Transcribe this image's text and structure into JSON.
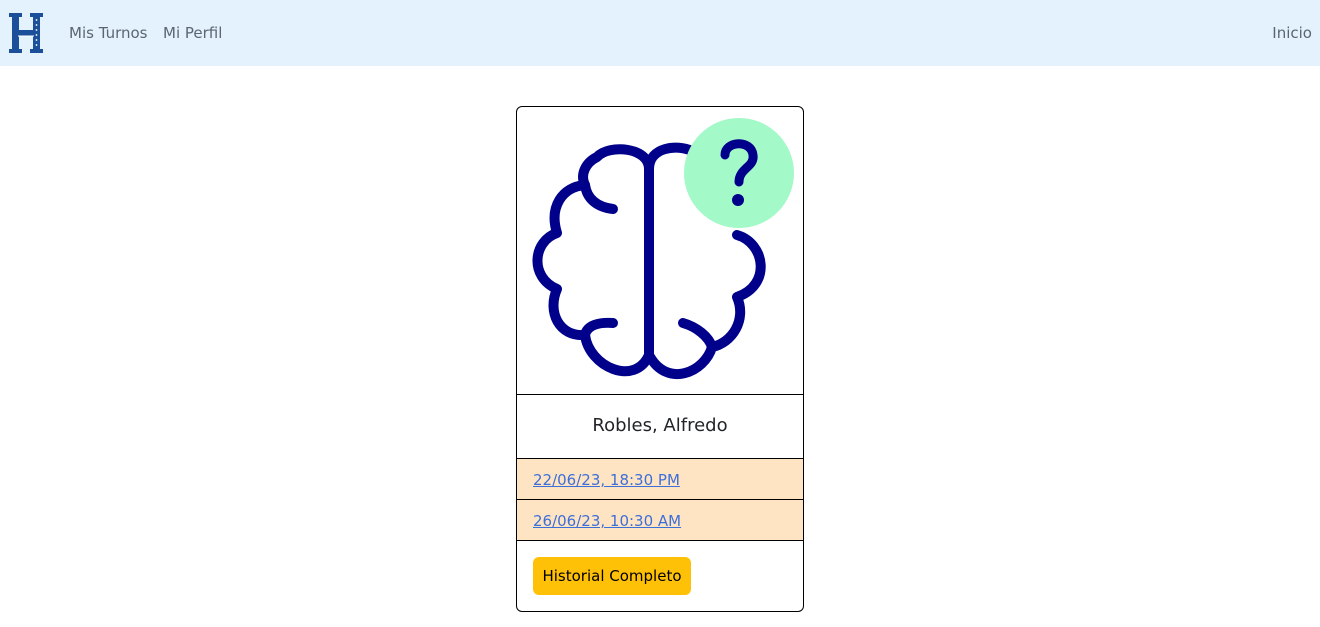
{
  "navbar": {
    "brand_icon": "hospital-h-logo",
    "links": {
      "mis_turnos": "Mis Turnos",
      "mi_perfil": "Mi Perfil",
      "inicio": "Inicio"
    },
    "background": "#e3f2fd"
  },
  "card": {
    "image_icon": "brain-question-icon",
    "doctor_name": "Robles, Alfredo",
    "appointments": [
      {
        "label": "22/06/23, 18:30 PM"
      },
      {
        "label": "26/06/23, 10:30 AM"
      }
    ],
    "history_button": "Historial Completo",
    "colors": {
      "brain_stroke": "#00008b",
      "question_circle": "#a3f9c8",
      "appointment_bg": "#ffe4c4",
      "button_bg": "#ffc107",
      "link": "#3d6fd8"
    }
  }
}
